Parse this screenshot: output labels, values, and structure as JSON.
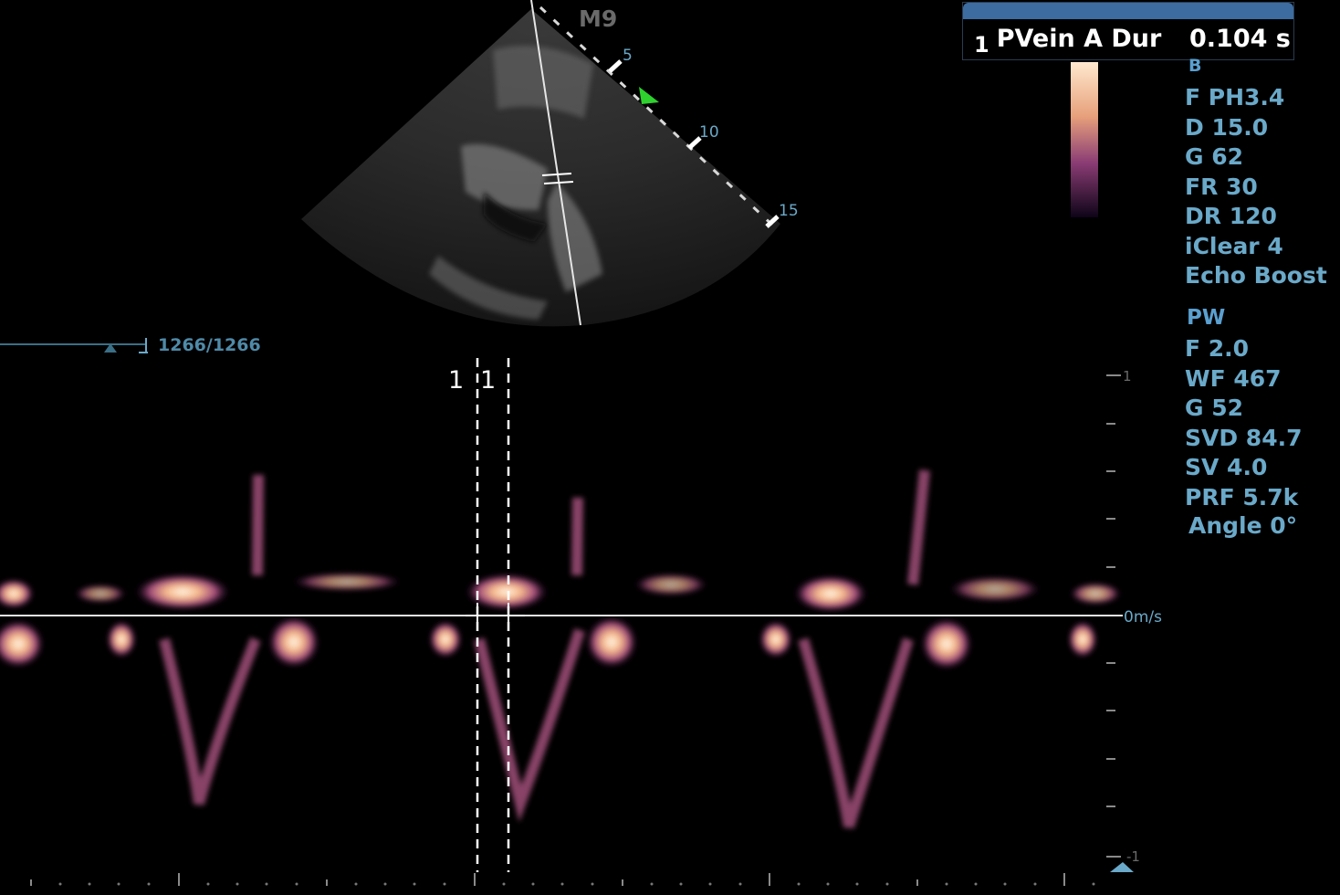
{
  "measurement": {
    "index": "1",
    "label": "PVein A Dur",
    "value": "0.104 s"
  },
  "probe_marker": "M9",
  "depth_scale": [
    "5",
    "10",
    "15"
  ],
  "b_mode": {
    "title": "B",
    "params": [
      "F PH3.4",
      "D 15.0",
      "G 62",
      "FR 30",
      "DR 120",
      "iClear 4",
      "Echo Boost"
    ]
  },
  "pw_mode": {
    "title": "PW",
    "params": [
      "F 2.0",
      "WF 467",
      "G 52",
      "SVD 84.7",
      "SV 4.0",
      "PRF 5.7k",
      "Angle 0°"
    ]
  },
  "frame_counter": "1266/1266",
  "cursor_labels": [
    "1",
    "1"
  ],
  "velocity_scale": {
    "top": "1",
    "baseline": "0m/s",
    "bottom": "-1"
  },
  "colors": {
    "label": "#6aa9c9",
    "measure_bar": "#3c6ca0",
    "green_marker": "#2ed12e"
  }
}
